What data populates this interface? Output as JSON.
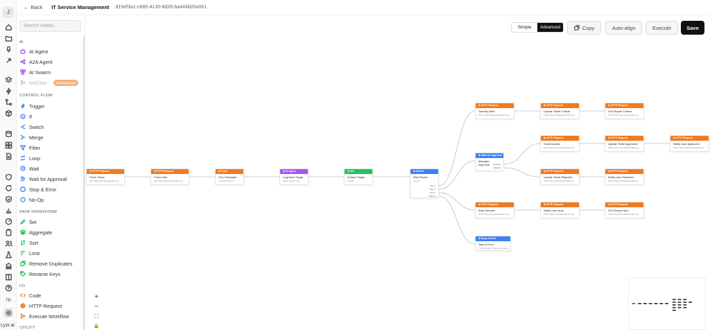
{
  "header": {
    "back_label": "Back",
    "title": "IT Service Management",
    "workflow_id": "d15ef3a1-c685-4130-8d26-ba444b00a061"
  },
  "rail": {
    "avatar": "J",
    "count": "7K",
    "brand": "Lyzr.ai"
  },
  "palette": {
    "search_placeholder": "Search nodes...",
    "sections": {
      "ai": "AI",
      "control_flow": "CONTROL FLOW",
      "data_transform": "DATA TRANSFORM",
      "io": "I/O",
      "utility": "UTILITY"
    },
    "items": {
      "ai_agent": "AI Agent",
      "a2a_agent": "A2A Agent",
      "ai_swarm": "AI Swarm",
      "gitclaw": "GitClaw",
      "gitclaw_badge": "coming soon",
      "trigger": "Trigger",
      "if": "If",
      "switch": "Switch",
      "merge": "Merge",
      "filter": "Filter",
      "loop": "Loop",
      "wait": "Wait",
      "wait_for_approval": "Wait for Approval",
      "stop_error": "Stop & Error",
      "noop": "No-Op",
      "set": "Set",
      "aggregate": "Aggregate",
      "sort": "Sort",
      "limit": "Limit",
      "remove_duplicates": "Remove Duplicates",
      "rename_keys": "Rename Keys",
      "code": "Code",
      "http_request": "HTTP Request",
      "execute_workflow": "Execute Workflow"
    }
  },
  "toolbar": {
    "mode_simple": "Simple",
    "mode_advanced": "Advanced",
    "copy": "Copy",
    "auto_align": "Auto-align",
    "execute": "Execute",
    "save": "Save"
  },
  "colors": {
    "http": "#f07a22",
    "code": "#f07a22",
    "ai_agent": "#a855f7",
    "set": "#22c55e",
    "switch": "#3b82f6",
    "approval": "#3b82f6",
    "stop": "#3b82f6"
  },
  "nodes": {
    "fetch_ticket": {
      "type": "HTTP Request",
      "title": "Fetch Ticket",
      "sub": "GET https://jsonplaceholder.typ..."
    },
    "fetch_user": {
      "type": "HTTP Request",
      "title": "Fetch User",
      "sub": "GET https://jsonplaceholder.typ..."
    },
    "sla_calc": {
      "type": "Code",
      "title": "SLA Calculator",
      "sub": "// Extract ticket & ..."
    },
    "cognitive_triage": {
      "type": "AI Agent",
      "title": "Cognitive Triage",
      "sub": "Agent: gpt-4o-mini"
    },
    "extract_triage": {
      "type": "Set",
      "title": "Extract Triage",
      "sub": "3 fields"
    },
    "risk_router": {
      "type": "Switch",
      "title": "Risk Router",
      "sub": "4 rules",
      "outputs": [
        "Case 1",
        "Case 2",
        "Case 3",
        "Fallback"
      ]
    },
    "security_alert": {
      "type": "HTTP Request",
      "title": "Security Alert",
      "sub": "POST https://jsonplaceholder.typ..."
    },
    "update_critical": {
      "type": "HTTP Request",
      "title": "Update Ticket Critical",
      "sub": "POST https://jsonplaceholder.typ..."
    },
    "sla_critical": {
      "type": "HTTP Request",
      "title": "SLA Report Critical",
      "sub": "POST https://jsonplaceholder.typ..."
    },
    "manager_approval": {
      "type": "Wait for Approval",
      "title": "Manager Approval",
      "sub": "",
      "outputs": [
        "Approved",
        "Rejected"
      ]
    },
    "grant_access": {
      "type": "HTTP Request",
      "title": "Grant Access",
      "sub": "POST https://jsonplaceholder.typ..."
    },
    "update_approved": {
      "type": "HTTP Request",
      "title": "Update Ticket Approved",
      "sub": "POST https://jsonplaceholder.typ..."
    },
    "notify_approved": {
      "type": "HTTP Request",
      "title": "Notify User Approved",
      "sub": "POST https://jsonplaceholder.typ..."
    },
    "update_rejected": {
      "type": "HTTP Request",
      "title": "Update Ticket Rejected",
      "sub": "POST https://jsonplaceholder.typ..."
    },
    "notify_rejected": {
      "type": "HTTP Request",
      "title": "Notify User Rejected",
      "sub": "POST https://jsonplaceholder.typ..."
    },
    "auto_resolve": {
      "type": "HTTP Request",
      "title": "Auto Resolve",
      "sub": "POST https://jsonplaceholder.typ..."
    },
    "notify_auto": {
      "type": "HTTP Request",
      "title": "Notify User Auto",
      "sub": "POST https://jsonplaceholder.typ..."
    },
    "sla_auto": {
      "type": "HTTP Request",
      "title": "SLA Report Auto",
      "sub": "POST https://jsonplaceholder.typ..."
    },
    "stop_error": {
      "type": "Stop & Error",
      "title": "Stop & Error",
      "sub": "The Cognitive Triage node gene..."
    }
  }
}
